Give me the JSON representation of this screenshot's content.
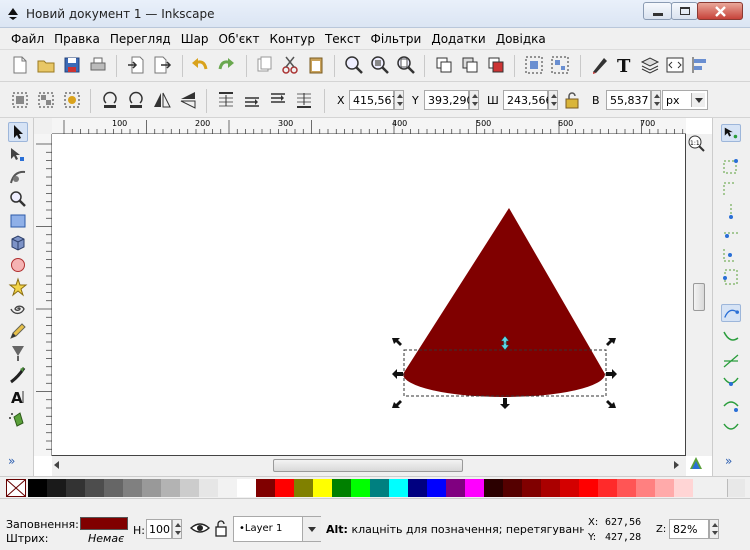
{
  "window": {
    "title": "Новий документ 1 — Inkscape"
  },
  "menu": [
    "Файл",
    "Правка",
    "Перегляд",
    "Шар",
    "Об'єкт",
    "Контур",
    "Текст",
    "Фільтри",
    "Додатки",
    "Довідка"
  ],
  "select_toolbar": {
    "x_label": "X",
    "x_value": "415,567",
    "y_label": "Y",
    "y_value": "393,290",
    "w_label": "Ш",
    "w_value": "243,566",
    "h_label": "В",
    "h_value": "55,837",
    "unit": "px"
  },
  "ruler": {
    "labels": [
      "100",
      "200",
      "300",
      "400",
      "500",
      "600",
      "700"
    ]
  },
  "zoom_corner": "1:1",
  "canvas": {
    "shape_color": "#800000"
  },
  "palette_colors": [
    "#000000",
    "#1a1a1a",
    "#333333",
    "#4d4d4d",
    "#666666",
    "#808080",
    "#999999",
    "#b3b3b3",
    "#cccccc",
    "#e6e6e6",
    "#f2f2f2",
    "#ffffff",
    "#800000",
    "#ff0000",
    "#808000",
    "#ffff00",
    "#008000",
    "#00ff00",
    "#008080",
    "#00ffff",
    "#000080",
    "#0000ff",
    "#800080",
    "#ff00ff",
    "#2b0000",
    "#550000",
    "#800000",
    "#aa0000",
    "#d40000",
    "#ff0000",
    "#ff2a2a",
    "#ff5555",
    "#ff8080",
    "#ffaaaa",
    "#ffd5d5"
  ],
  "statusbar": {
    "fill_label": "Заповнення:",
    "fill_color": "#800000",
    "stroke_label": "Штрих:",
    "stroke_value": "Немає",
    "opacity_label": "Н:",
    "opacity_value": "100",
    "layer": "•Layer 1",
    "message_bold": "Alt:",
    "message": " клацніть для позначення; перетягування д.",
    "x_label": "X:",
    "x_coord": "627,56",
    "y_label": "Y:",
    "y_coord": "427,28",
    "zoom_label": "Z:",
    "zoom_value": "82%"
  }
}
